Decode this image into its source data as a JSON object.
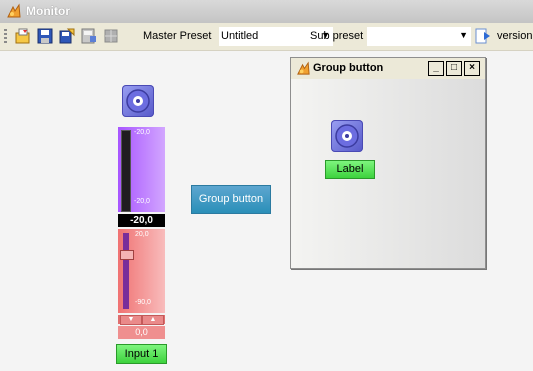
{
  "app": {
    "title": "Monitor"
  },
  "toolbar": {
    "master_preset_label": "Master Preset",
    "master_preset_value": "Untitled",
    "sub_preset_label": "Sub preset",
    "sub_preset_value": "",
    "version_label": "version"
  },
  "channel": {
    "vu_top_tick": "-20,0",
    "vu_bottom_tick": "-20,0",
    "vu_readout": "-20,0",
    "fader_top_tick": "20,0",
    "fader_bottom_tick": "-90,0",
    "fader_readout": "0,0",
    "input_label": "Input 1"
  },
  "group_button": {
    "label": "Group button"
  },
  "group_window": {
    "title": "Group button",
    "label_button": "Label",
    "min_glyph": "_",
    "max_glyph": "□",
    "close_glyph": "×"
  },
  "colors": {
    "vu_panel": "#b070ff",
    "fader_panel": "#f08080",
    "green_button": "#5ee65e",
    "group_button": "#3a9ac4",
    "title_bar": "#cfcfcf"
  }
}
